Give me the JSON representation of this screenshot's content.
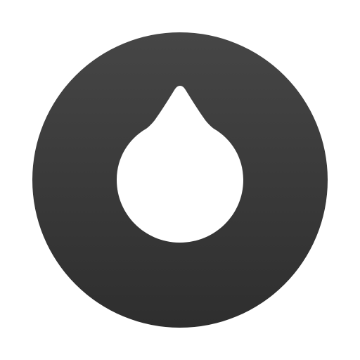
{
  "app_icon": {
    "name": "drop-logo-icon",
    "colors": {
      "page_background": "#ffffff",
      "circle_gradient_top": "#464646",
      "circle_gradient_bottom": "#2e2e2e",
      "drop_fill": "#ffffff"
    }
  }
}
